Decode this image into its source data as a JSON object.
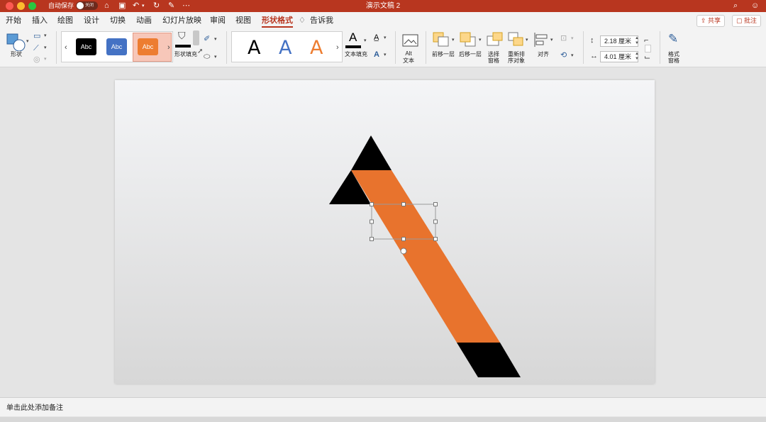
{
  "window": {
    "autosave_label": "自动保存",
    "autosave_state": "关闭",
    "title": "演示文稿 2"
  },
  "tabs": [
    {
      "label": "开始"
    },
    {
      "label": "插入"
    },
    {
      "label": "绘图"
    },
    {
      "label": "设计"
    },
    {
      "label": "切换"
    },
    {
      "label": "动画"
    },
    {
      "label": "幻灯片放映"
    },
    {
      "label": "审阅"
    },
    {
      "label": "视图"
    },
    {
      "label": "形状格式",
      "active": true
    },
    {
      "label": "告诉我"
    }
  ],
  "header_buttons": {
    "share": "共享",
    "comments": "批注"
  },
  "ribbon": {
    "shape_label": "形状",
    "style_samples": [
      {
        "text": "Abc",
        "color": "#000000"
      },
      {
        "text": "Abc",
        "color": "#4472c4"
      },
      {
        "text": "Abc",
        "color": "#ed7d31",
        "selected": true
      }
    ],
    "shape_fill_label": "形状填充",
    "wordart_samples": [
      {
        "text": "A",
        "color": "#000000"
      },
      {
        "text": "A",
        "color": "#4472c4"
      },
      {
        "text": "A",
        "color": "#ed7d31"
      }
    ],
    "text_fill_label": "文本填充",
    "alt_text_label": "Alt\n文本",
    "bring_forward_label": "前移一层",
    "send_backward_label": "后移一层",
    "selection_pane_label": "选择\n窗格",
    "reorder_label": "重新排\n序对象",
    "align_label": "对齐",
    "height_value": "2.18 厘米",
    "width_value": "4.01 厘米",
    "format_pane_label": "格式\n窗格"
  },
  "slide": {
    "colors": {
      "accent": "#e8732d",
      "black": "#000000"
    }
  },
  "notes": {
    "placeholder": "单击此处添加备注"
  }
}
